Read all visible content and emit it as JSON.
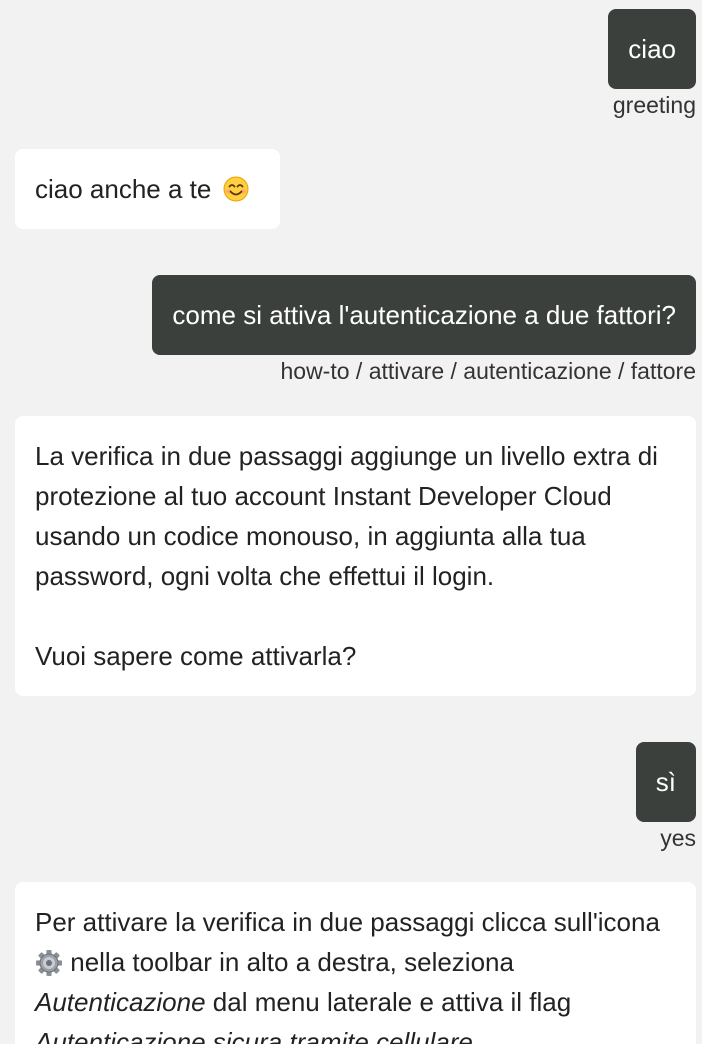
{
  "messages": [
    {
      "role": "user",
      "text": "ciao",
      "tag": "greeting"
    },
    {
      "role": "bot",
      "text": "ciao anche a te",
      "emoji": "smiling-face-emoji"
    },
    {
      "role": "user",
      "text": "come si attiva l'autenticazione a due fattori?",
      "tag": "how-to / attivare / autenticazione / fattore"
    },
    {
      "role": "bot",
      "paragraph1": "La verifica in due passaggi aggiunge un livello extra di protezione al tuo account Instant Developer Cloud usando un codice monouso, in aggiunta alla tua password, ogni volta che effettui il login.",
      "paragraph2": "Vuoi sapere come attivarla?"
    },
    {
      "role": "user",
      "text": "sì",
      "tag": "yes"
    },
    {
      "role": "bot",
      "part1": "Per attivare la verifica in due passaggi clicca sull'icona",
      "icon": "gear-icon",
      "part2": " nella toolbar in alto a destra, seleziona ",
      "em1": "Autenticazione",
      "part3": " dal menu laterale e attiva il flag ",
      "em2": "Autenticazione sicura tramite cellulare"
    }
  ],
  "colors": {
    "background": "#f2f2f2",
    "user_bubble": "#3b403c",
    "bot_bubble": "#ffffff",
    "user_text": "#ffffff",
    "bot_text": "#222222"
  }
}
